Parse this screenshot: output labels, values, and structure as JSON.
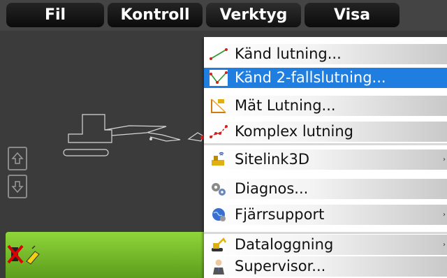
{
  "menubar": {
    "items": [
      {
        "label": "Fil"
      },
      {
        "label": "Kontroll"
      },
      {
        "label": "Verktyg"
      },
      {
        "label": "Visa"
      }
    ]
  },
  "menu": {
    "items": [
      {
        "label": "Känd lutning...",
        "icon": "line-slope-icon",
        "selected": false,
        "submenu": false
      },
      {
        "label": "Känd 2-fallslutning...",
        "icon": "two-slope-icon",
        "selected": true,
        "submenu": false
      },
      {
        "label": "Mät Lutning...",
        "icon": "measure-slope-icon",
        "selected": false,
        "submenu": false
      },
      {
        "label": "Komplex lutning",
        "icon": "complex-slope-icon",
        "selected": false,
        "submenu": false
      },
      {
        "label": "Sitelink3D",
        "icon": "sitelink-icon",
        "selected": false,
        "submenu": true
      },
      {
        "label": "Diagnos...",
        "icon": "gears-icon",
        "selected": false,
        "submenu": false
      },
      {
        "label": "Fjärrsupport",
        "icon": "globe-icon",
        "selected": false,
        "submenu": true
      },
      {
        "label": "Dataloggning",
        "icon": "excavator-icon",
        "selected": false,
        "submenu": true
      },
      {
        "label": "Supervisor...",
        "icon": "person-icon",
        "selected": false,
        "submenu": false
      }
    ],
    "submenu_arrow": "›"
  },
  "colors": {
    "highlight": "#1f7ee0",
    "status_bar": "#7ccc2c",
    "background": "#3b3b3b"
  }
}
